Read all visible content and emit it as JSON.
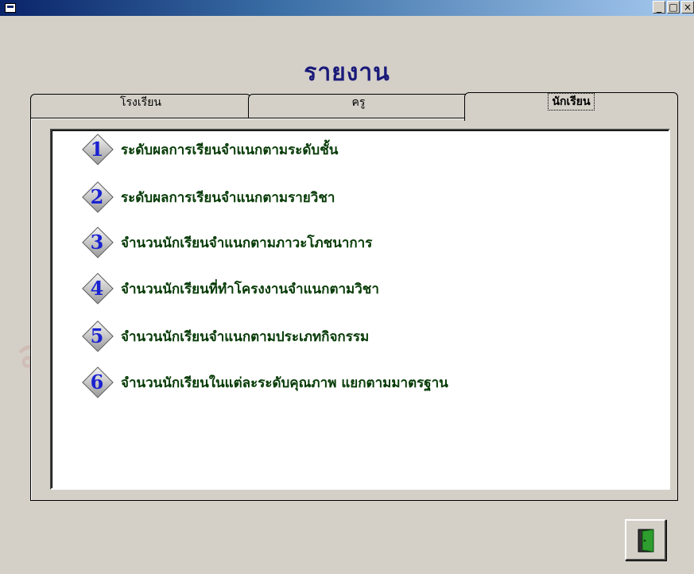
{
  "window": {
    "title": "",
    "controls": [
      "_",
      "□",
      "×"
    ]
  },
  "watermark": [
    "สถาบันวิทยบริการ",
    "จุฬาลงกรณ์มหาวิทยาลัย"
  ],
  "heading": "รายงาน",
  "tabs": [
    {
      "label": "โรงเรียน",
      "active": false
    },
    {
      "label": "ครู",
      "active": false
    },
    {
      "label": "นักเรียน",
      "active": true
    }
  ],
  "report_items": [
    {
      "num": "1",
      "label": "ระดับผลการเรียนจำแนกตามระดับชั้น"
    },
    {
      "num": "2",
      "label": "ระดับผลการเรียนจำแนกตามรายวิชา"
    },
    {
      "num": "3",
      "label": "จำนวนนักเรียนจำแนกตามภาวะโภชนาการ"
    },
    {
      "num": "4",
      "label": "จำนวนนักเรียนที่ทำโครงงานจำแนกตามวิชา"
    },
    {
      "num": "5",
      "label": "จำนวนนักเรียนจำแนกตามประเภทกิจกรรม"
    },
    {
      "num": "6",
      "label": "จำนวนนักเรียนในแต่ละระดับคุณภาพ แยกตามมาตรฐาน"
    }
  ],
  "colors": {
    "title_bar": "#0a246a",
    "item_text": "#063a06",
    "number": "#1a22d0",
    "heading": "#1a1a7a"
  },
  "icons": {
    "exit": "exit-door-icon"
  }
}
